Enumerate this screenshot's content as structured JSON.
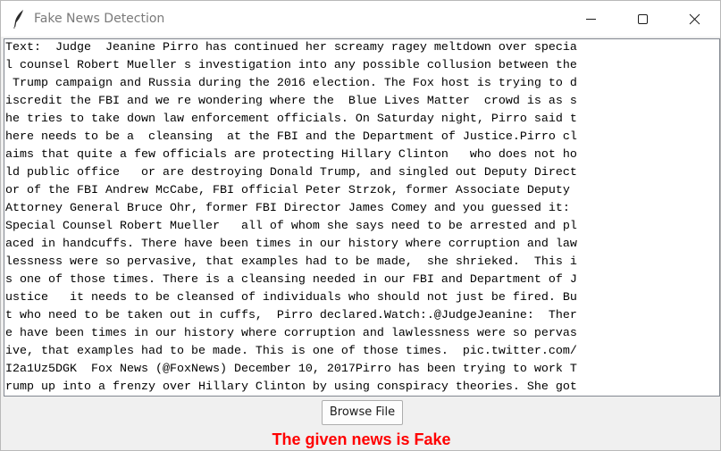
{
  "window": {
    "title": "Fake News Detection",
    "app_icon": "feather-icon",
    "controls": {
      "minimize_icon": "minimize-icon",
      "maximize_icon": "maximize-icon",
      "close_icon": "close-icon"
    }
  },
  "text_area": {
    "lines": [
      "Text:  Judge  Jeanine Pirro has continued her screamy ragey meltdown over specia",
      "l counsel Robert Mueller s investigation into any possible collusion between the",
      " Trump campaign and Russia during the 2016 election. The Fox host is trying to d",
      "iscredit the FBI and we re wondering where the  Blue Lives Matter  crowd is as s",
      "he tries to take down law enforcement officials. On Saturday night, Pirro said t",
      "here needs to be a  cleansing  at the FBI and the Department of Justice.Pirro cl",
      "aims that quite a few officials are protecting Hillary Clinton   who does not ho",
      "ld public office   or are destroying Donald Trump, and singled out Deputy Direct",
      "or of the FBI Andrew McCabe, FBI official Peter Strzok, former Associate Deputy ",
      "Attorney General Bruce Ohr, former FBI Director James Comey and you guessed it: ",
      "Special Counsel Robert Mueller   all of whom she says need to be arrested and pl",
      "aced in handcuffs. There have been times in our history where corruption and law",
      "lessness were so pervasive, that examples had to be made,  she shrieked.  This i",
      "s one of those times. There is a cleansing needed in our FBI and Department of J",
      "ustice   it needs to be cleansed of individuals who should not just be fired. Bu",
      "t who need to be taken out in cuffs,  Pirro declared.Watch:.@JudgeJeanine:  Ther",
      "e have been times in our history where corruption and lawlessness were so pervas",
      "ive, that examples had to be made. This is one of those times.  pic.twitter.com/",
      "I2a1Uz5DGK  Fox News (@FoxNews) December 10, 2017Pirro has been trying to work T",
      "rump up into a frenzy over Hillary Clinton by using conspiracy theories. She got"
    ]
  },
  "browse_button": {
    "label": "Browse File"
  },
  "result": {
    "text": "The given news is Fake",
    "color": "#ff0000"
  }
}
